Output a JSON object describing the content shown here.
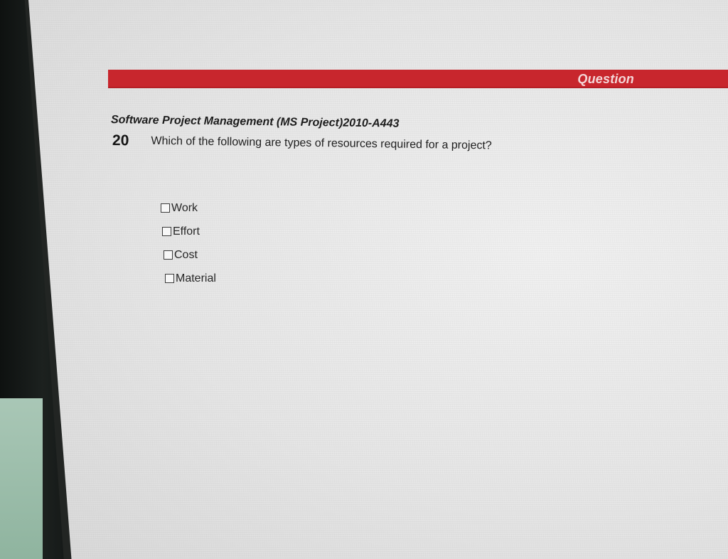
{
  "header": {
    "title": "Question"
  },
  "quiz": {
    "course_title": "Software Project Management (MS Project)2010-A443",
    "question_number": "20",
    "question_text": "Which of the following are types of resources required for a project?",
    "options": [
      {
        "label": "Work",
        "checked": false
      },
      {
        "label": "Effort",
        "checked": false
      },
      {
        "label": "Cost",
        "checked": false
      },
      {
        "label": "Material",
        "checked": false
      }
    ]
  },
  "colors": {
    "header_bar": "#c8262d",
    "header_text": "#f4d7d8",
    "screen_background": "#e8e8e8",
    "text": "#1d1d1d"
  }
}
